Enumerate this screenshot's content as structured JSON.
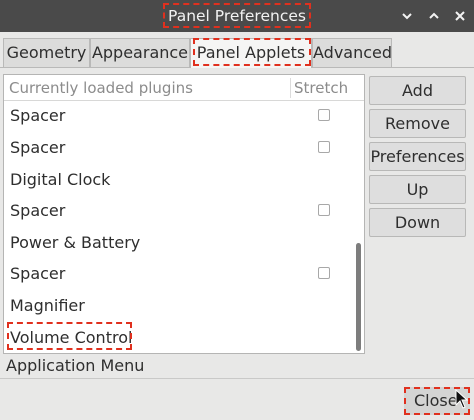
{
  "window": {
    "title": "Panel Preferences",
    "controls": {
      "minimize_icon": "chevron-down-icon",
      "maximize_icon": "chevron-up-icon",
      "close_icon": "close-icon"
    }
  },
  "tabs": [
    {
      "label": "Geometry",
      "active": false
    },
    {
      "label": "Appearance",
      "active": false
    },
    {
      "label": "Panel Applets",
      "active": true
    },
    {
      "label": "Advanced",
      "active": false
    }
  ],
  "plugin_list": {
    "header_plugins": "Currently loaded plugins",
    "header_stretch": "Stretch",
    "items": [
      {
        "label": "Spacer",
        "has_checkbox": true,
        "checked": false
      },
      {
        "label": "Spacer",
        "has_checkbox": true,
        "checked": false
      },
      {
        "label": "Digital Clock",
        "has_checkbox": false
      },
      {
        "label": "Spacer",
        "has_checkbox": true,
        "checked": false
      },
      {
        "label": "Power & Battery",
        "has_checkbox": false
      },
      {
        "label": "Spacer",
        "has_checkbox": true,
        "checked": false
      },
      {
        "label": "Magnifier",
        "has_checkbox": false
      },
      {
        "label": "Volume Control",
        "has_checkbox": false
      }
    ],
    "below_list": "Application Menu"
  },
  "side_buttons": {
    "add": "Add",
    "remove": "Remove",
    "preferences": "Preferences",
    "up": "Up",
    "down": "Down"
  },
  "footer": {
    "close_label": "Close"
  },
  "colors": {
    "titlebar": "#4a4a4a",
    "highlight_dash": "#e0301e",
    "window_bg": "#e8e8e7"
  }
}
